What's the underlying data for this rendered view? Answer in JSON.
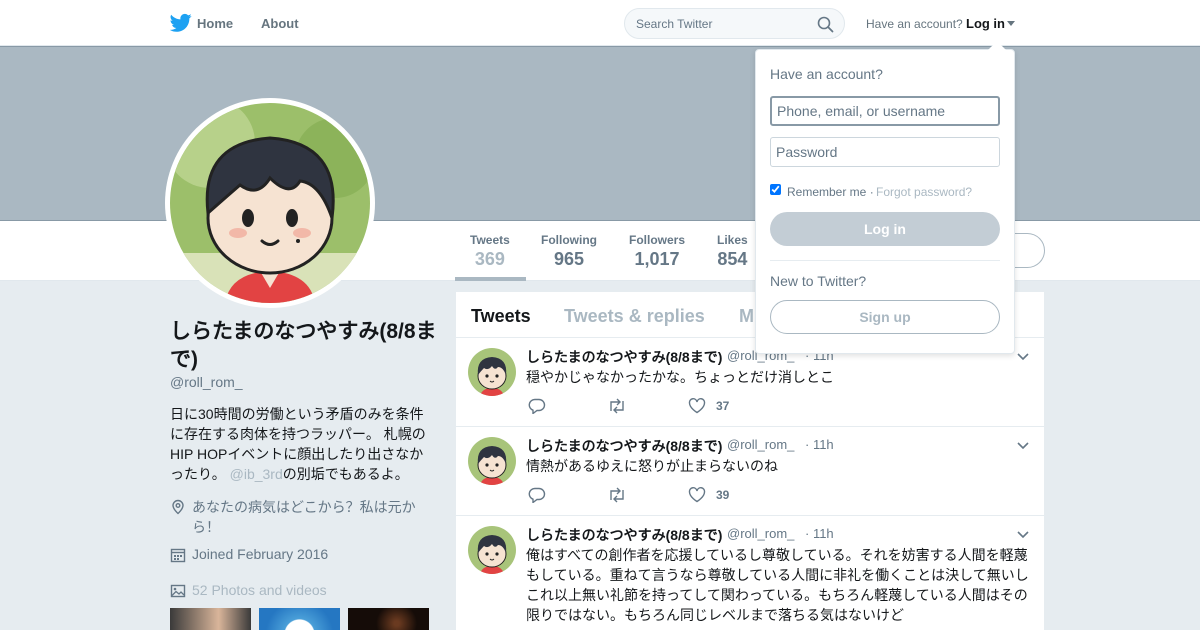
{
  "nav": {
    "logo_icon": "twitter-bird-icon",
    "home": "Home",
    "about": "About",
    "search_placeholder": "Search Twitter",
    "have_account": "Have an account?",
    "login": "Log in"
  },
  "colors": {
    "brand": "#1da1f2",
    "muted": "#aab8c2",
    "text": "#14171a",
    "secondary": "#657786"
  },
  "stats": [
    {
      "label": "Tweets",
      "value": "369"
    },
    {
      "label": "Following",
      "value": "965"
    },
    {
      "label": "Followers",
      "value": "1,017"
    },
    {
      "label": "Likes",
      "value": "854"
    }
  ],
  "profile": {
    "name": "しらたまのなつやすみ(8/8まで)",
    "handle": "@roll_rom_",
    "bio_before": "日に30時間の労働という矛盾のみを条件に存在する肉体を持つラッパー。 札幌のHIP HOPイベントに顔出したり出さなかったり。 ",
    "bio_mention": "@ib_3rd",
    "bio_after": "の別垢でもあるよ。",
    "location": "あなたの病気はどこから？私は元から！",
    "joined": "Joined February 2016",
    "photos": "52 Photos and videos"
  },
  "timeline": {
    "tabs": [
      "Tweets",
      "Tweets & replies",
      "M"
    ],
    "tweets": [
      {
        "name": "しらたまのなつやすみ(8/8まで)",
        "handle": "@roll_rom_",
        "time": "· 11h",
        "text": "穏やかじゃなかったかな。ちょっとだけ消しとこ",
        "likes": "37"
      },
      {
        "name": "しらたまのなつやすみ(8/8まで)",
        "handle": "@roll_rom_",
        "time": "· 11h",
        "text": "情熱があるゆえに怒りが止まらないのね",
        "likes": "39"
      },
      {
        "name": "しらたまのなつやすみ(8/8まで)",
        "handle": "@roll_rom_",
        "time": "· 11h",
        "text": "俺はすべての創作者を応援しているし尊敬している。それを妨害する人間を軽蔑もしている。重ねて言うなら尊敬している人間に非礼を働くことは決して無いしこれ以上無い礼節を持ってして関わっている。もちろん軽蔑している人間はその限りではない。もちろん同じレベルまで落ちる気はないけど"
      }
    ]
  },
  "login_dropdown": {
    "title": "Have an account?",
    "username_placeholder": "Phone, email, or username",
    "password_placeholder": "Password",
    "remember": "Remember me",
    "separator": " · ",
    "forgot": "Forgot password?",
    "login_button": "Log in",
    "new_to": "New to Twitter?",
    "signup_button": "Sign up"
  }
}
